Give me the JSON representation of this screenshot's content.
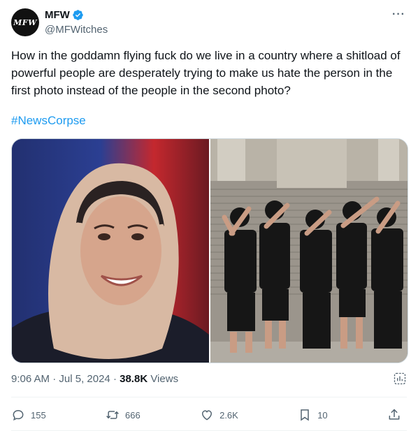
{
  "author": {
    "avatar_text": "MFW",
    "display_name": "MFW",
    "handle": "@MFWitches"
  },
  "tweet": {
    "text": "How in the goddamn flying fuck do we live in a country where a shitload of powerful people are desperately trying to make us hate the person in the first photo instead of the people in the second photo?",
    "hashtag": "#NewsCorpse",
    "time": "9:06 AM",
    "date": "Jul 5, 2024",
    "views_count": "38.8K",
    "views_label": "Views"
  },
  "actions": {
    "replies": "155",
    "reposts": "666",
    "likes": "2.6K",
    "bookmarks": "10"
  },
  "colors": {
    "accent": "#1d9bf0",
    "secondary_text": "#536471",
    "primary_text": "#0f1419"
  },
  "icons": [
    "verified-badge-icon",
    "more-icon",
    "analytics-icon",
    "reply-icon",
    "repost-icon",
    "like-icon",
    "bookmark-icon",
    "share-icon"
  ]
}
